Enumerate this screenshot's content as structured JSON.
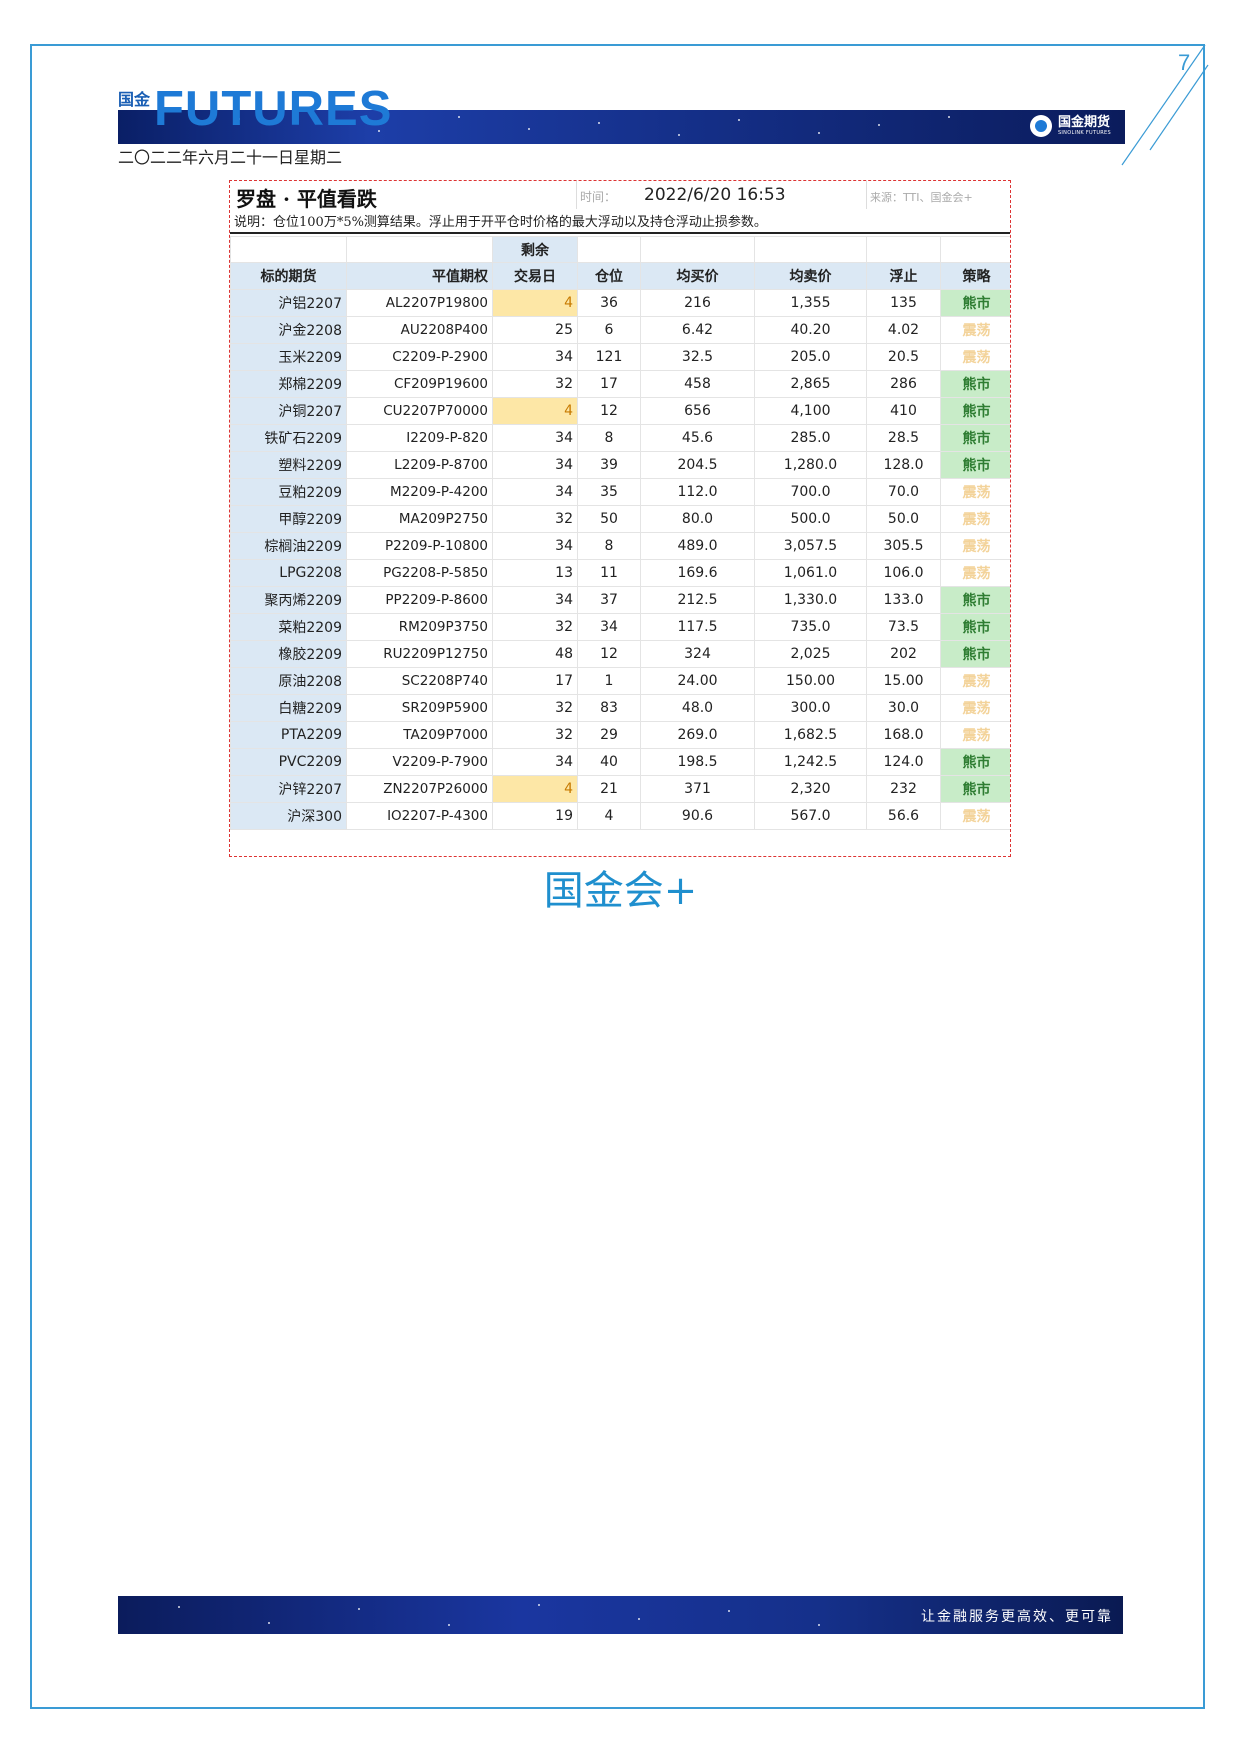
{
  "page": {
    "number": "7"
  },
  "header": {
    "logo_cn_top": "国金",
    "logo_cn_bottom": "会 +",
    "logo_word": "FUTURES",
    "brand_cn": "国金期货",
    "brand_en": "SINOLINK FUTURES",
    "date": "二〇二二年六月二十一日星期二"
  },
  "report": {
    "title": "罗盘 · 平值看跌",
    "time_label": "时间：",
    "time_value": "2022/6/20 16:53",
    "source": "来源：TTI、国金会+",
    "note": "说明：仓位100万*5%测算结果。浮止用于开平仓时价格的最大浮动以及持仓浮动止损参数。",
    "headers": {
      "underlying": "标的期货",
      "option": "平值期权",
      "days_top": "剩余",
      "days": "交易日",
      "position": "仓位",
      "avg_buy": "均买价",
      "avg_sell": "均卖价",
      "float_stop": "浮止",
      "strategy": "策略"
    },
    "rows": [
      {
        "underlying": "沪铝2207",
        "option": "AL2207P19800",
        "days": "4",
        "position": "36",
        "avg_buy": "216",
        "avg_sell": "1,355",
        "float_stop": "135",
        "strategy": "熊市",
        "bear": true,
        "hl": true
      },
      {
        "underlying": "沪金2208",
        "option": "AU2208P400",
        "days": "25",
        "position": "6",
        "avg_buy": "6.42",
        "avg_sell": "40.20",
        "float_stop": "4.02",
        "strategy": "震荡",
        "bear": false,
        "hl": false
      },
      {
        "underlying": "玉米2209",
        "option": "C2209-P-2900",
        "days": "34",
        "position": "121",
        "avg_buy": "32.5",
        "avg_sell": "205.0",
        "float_stop": "20.5",
        "strategy": "震荡",
        "bear": false,
        "hl": false
      },
      {
        "underlying": "郑棉2209",
        "option": "CF209P19600",
        "days": "32",
        "position": "17",
        "avg_buy": "458",
        "avg_sell": "2,865",
        "float_stop": "286",
        "strategy": "熊市",
        "bear": true,
        "hl": false
      },
      {
        "underlying": "沪铜2207",
        "option": "CU2207P70000",
        "days": "4",
        "position": "12",
        "avg_buy": "656",
        "avg_sell": "4,100",
        "float_stop": "410",
        "strategy": "熊市",
        "bear": true,
        "hl": true
      },
      {
        "underlying": "铁矿石2209",
        "option": "I2209-P-820",
        "days": "34",
        "position": "8",
        "avg_buy": "45.6",
        "avg_sell": "285.0",
        "float_stop": "28.5",
        "strategy": "熊市",
        "bear": true,
        "hl": false
      },
      {
        "underlying": "塑料2209",
        "option": "L2209-P-8700",
        "days": "34",
        "position": "39",
        "avg_buy": "204.5",
        "avg_sell": "1,280.0",
        "float_stop": "128.0",
        "strategy": "熊市",
        "bear": true,
        "hl": false
      },
      {
        "underlying": "豆粕2209",
        "option": "M2209-P-4200",
        "days": "34",
        "position": "35",
        "avg_buy": "112.0",
        "avg_sell": "700.0",
        "float_stop": "70.0",
        "strategy": "震荡",
        "bear": false,
        "hl": false
      },
      {
        "underlying": "甲醇2209",
        "option": "MA209P2750",
        "days": "32",
        "position": "50",
        "avg_buy": "80.0",
        "avg_sell": "500.0",
        "float_stop": "50.0",
        "strategy": "震荡",
        "bear": false,
        "hl": false
      },
      {
        "underlying": "棕榈油2209",
        "option": "P2209-P-10800",
        "days": "34",
        "position": "8",
        "avg_buy": "489.0",
        "avg_sell": "3,057.5",
        "float_stop": "305.5",
        "strategy": "震荡",
        "bear": false,
        "hl": false
      },
      {
        "underlying": "LPG2208",
        "option": "PG2208-P-5850",
        "days": "13",
        "position": "11",
        "avg_buy": "169.6",
        "avg_sell": "1,061.0",
        "float_stop": "106.0",
        "strategy": "震荡",
        "bear": false,
        "hl": false
      },
      {
        "underlying": "聚丙烯2209",
        "option": "PP2209-P-8600",
        "days": "34",
        "position": "37",
        "avg_buy": "212.5",
        "avg_sell": "1,330.0",
        "float_stop": "133.0",
        "strategy": "熊市",
        "bear": true,
        "hl": false
      },
      {
        "underlying": "菜粕2209",
        "option": "RM209P3750",
        "days": "32",
        "position": "34",
        "avg_buy": "117.5",
        "avg_sell": "735.0",
        "float_stop": "73.5",
        "strategy": "熊市",
        "bear": true,
        "hl": false
      },
      {
        "underlying": "橡胶2209",
        "option": "RU2209P12750",
        "days": "48",
        "position": "12",
        "avg_buy": "324",
        "avg_sell": "2,025",
        "float_stop": "202",
        "strategy": "熊市",
        "bear": true,
        "hl": false
      },
      {
        "underlying": "原油2208",
        "option": "SC2208P740",
        "days": "17",
        "position": "1",
        "avg_buy": "24.00",
        "avg_sell": "150.00",
        "float_stop": "15.00",
        "strategy": "震荡",
        "bear": false,
        "hl": false
      },
      {
        "underlying": "白糖2209",
        "option": "SR209P5900",
        "days": "32",
        "position": "83",
        "avg_buy": "48.0",
        "avg_sell": "300.0",
        "float_stop": "30.0",
        "strategy": "震荡",
        "bear": false,
        "hl": false
      },
      {
        "underlying": "PTA2209",
        "option": "TA209P7000",
        "days": "32",
        "position": "29",
        "avg_buy": "269.0",
        "avg_sell": "1,682.5",
        "float_stop": "168.0",
        "strategy": "震荡",
        "bear": false,
        "hl": false
      },
      {
        "underlying": "PVC2209",
        "option": "V2209-P-7900",
        "days": "34",
        "position": "40",
        "avg_buy": "198.5",
        "avg_sell": "1,242.5",
        "float_stop": "124.0",
        "strategy": "熊市",
        "bear": true,
        "hl": false
      },
      {
        "underlying": "沪锌2207",
        "option": "ZN2207P26000",
        "days": "4",
        "position": "21",
        "avg_buy": "371",
        "avg_sell": "2,320",
        "float_stop": "232",
        "strategy": "熊市",
        "bear": true,
        "hl": true
      },
      {
        "underlying": "沪深300",
        "option": "IO2207-P-4300",
        "days": "19",
        "position": "4",
        "avg_buy": "90.6",
        "avg_sell": "567.0",
        "float_stop": "56.6",
        "strategy": "震荡",
        "bear": false,
        "hl": false
      }
    ]
  },
  "caption": "国金会+",
  "footer": {
    "slogan": "让金融服务更高效、更可靠"
  },
  "colors": {
    "frame": "#3a9bd5",
    "band": "#15308a",
    "bear_bg": "#c8ecc8",
    "highlight": "#fde7a6",
    "underlying_bg": "#dbe8f4"
  }
}
